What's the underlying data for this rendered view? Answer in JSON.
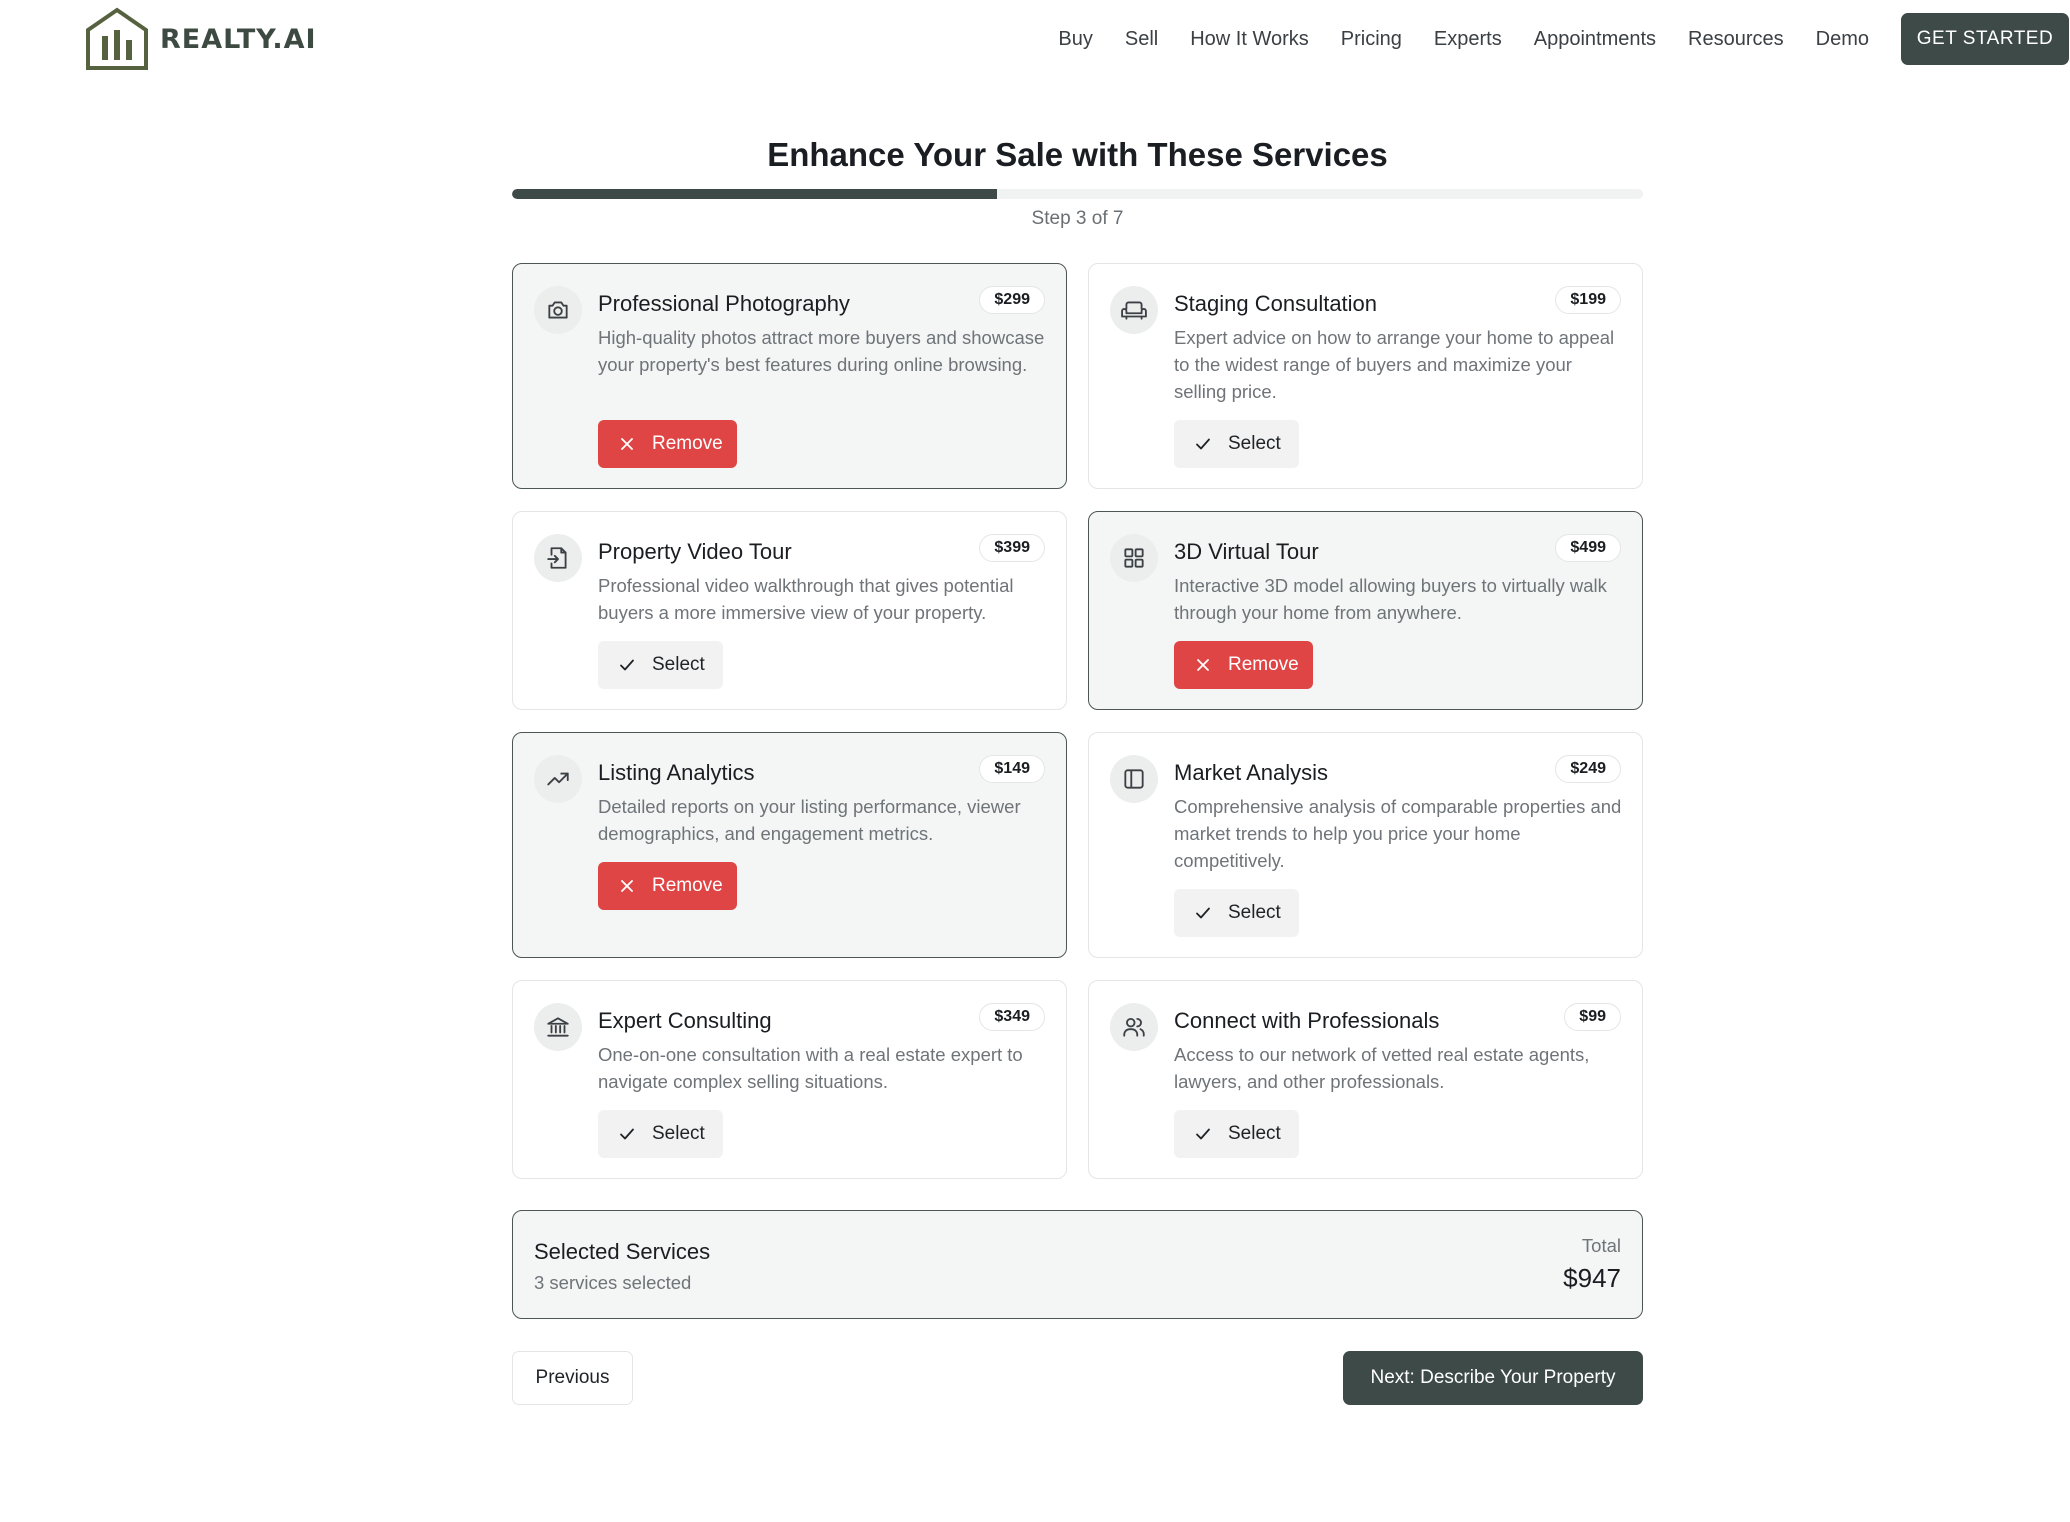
{
  "brand": {
    "name": "REALTY.AI",
    "color": "#56613f"
  },
  "nav": {
    "items": [
      "Buy",
      "Sell",
      "How It Works",
      "Pricing",
      "Experts",
      "Appointments",
      "Resources",
      "Demo"
    ],
    "cta": "GET STARTED"
  },
  "page": {
    "title": "Enhance Your Sale with These Services",
    "step_label": "Step 3 of 7",
    "progress_fraction": 0.4286
  },
  "services": [
    {
      "title": "Professional Photography",
      "price": "$299",
      "description": "High-quality photos attract more buyers and showcase your property's best features during online browsing.",
      "selected": true,
      "icon": "camera-icon",
      "button": "Remove"
    },
    {
      "title": "Staging Consultation",
      "price": "$199",
      "description": "Expert advice on how to arrange your home to appeal to the widest range of buyers and maximize your selling price.",
      "selected": false,
      "icon": "sofa-icon",
      "button": "Select"
    },
    {
      "title": "Property Video Tour",
      "price": "$399",
      "description": "Professional video walkthrough that gives potential buyers a more immersive view of your property.",
      "selected": false,
      "icon": "file-import-icon",
      "button": "Select"
    },
    {
      "title": "3D Virtual Tour",
      "price": "$499",
      "description": "Interactive 3D model allowing buyers to virtually walk through your home from anywhere.",
      "selected": true,
      "icon": "grid-icon",
      "button": "Remove"
    },
    {
      "title": "Listing Analytics",
      "price": "$149",
      "description": "Detailed reports on your listing performance, viewer demographics, and engagement metrics.",
      "selected": true,
      "icon": "trending-up-icon",
      "button": "Remove"
    },
    {
      "title": "Market Analysis",
      "price": "$249",
      "description": "Comprehensive analysis of comparable properties and market trends to help you price your home competitively.",
      "selected": false,
      "icon": "panel-icon",
      "button": "Select"
    },
    {
      "title": "Expert Consulting",
      "price": "$349",
      "description": "One-on-one consultation with a real estate expert to navigate complex selling situations.",
      "selected": false,
      "icon": "bank-icon",
      "button": "Select"
    },
    {
      "title": "Connect with Professionals",
      "price": "$99",
      "description": "Access to our network of vetted real estate agents, lawyers, and other professionals.",
      "selected": false,
      "icon": "users-icon",
      "button": "Select"
    }
  ],
  "summary": {
    "title": "Selected Services",
    "count_text": "3 services selected",
    "total_label": "Total",
    "total": "$947"
  },
  "footer": {
    "previous": "Previous",
    "next": "Next: Describe Your Property"
  },
  "colors": {
    "primary": "#3d4a47",
    "remove": "#df4545",
    "selected_bg": "#f4f6f5"
  }
}
